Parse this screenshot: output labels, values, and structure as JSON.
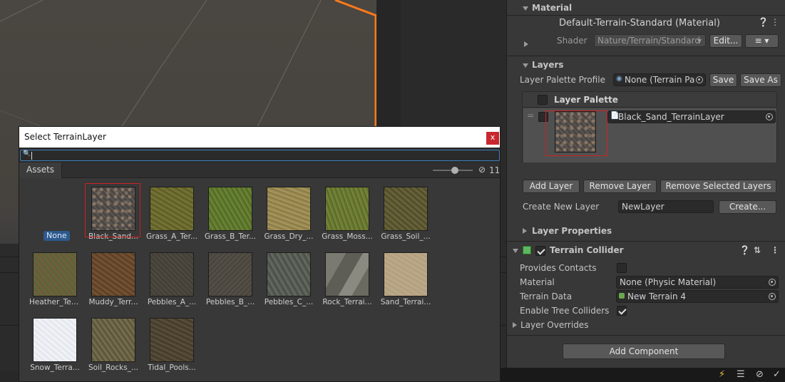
{
  "inspector": {
    "material": {
      "header": "Material",
      "name": "Default-Terrain-Standard (Material)",
      "shader_label": "Shader",
      "shader_value": "Nature/Terrain/Standard",
      "edit_label": "Edit..."
    },
    "layers": {
      "header": "Layers",
      "palette_profile_label": "Layer Palette Profile",
      "palette_profile_value": "None (Terrain Pa",
      "save_label": "Save",
      "save_as_label": "Save As",
      "palette_title": "Layer Palette",
      "selected_layer": "Black_Sand_TerrainLayer",
      "add_layer": "Add Layer",
      "remove_layer": "Remove Layer",
      "remove_selected": "Remove Selected Layers",
      "create_new_label": "Create New Layer",
      "new_layer_value": "NewLayer",
      "create_button": "Create...",
      "properties_header": "Layer Properties"
    },
    "collider": {
      "header": "Terrain Collider",
      "provides_contacts_label": "Provides Contacts",
      "provides_contacts": false,
      "material_label": "Material",
      "material_value": "None (Physic Material)",
      "terrain_data_label": "Terrain Data",
      "terrain_data_value": "New Terrain 4",
      "tree_colliders_label": "Enable Tree Colliders",
      "tree_colliders": true,
      "overrides_header": "Layer Overrides"
    },
    "add_component": "Add Component"
  },
  "dialog": {
    "title": "Select TerrainLayer",
    "close_label": "x",
    "search_value": "",
    "tab_assets": "Assets",
    "hidden_count": "11",
    "none_label": "None",
    "items": [
      {
        "name": "Black_Sand...",
        "tex": "t-black",
        "selected": true
      },
      {
        "name": "Grass_A_Ter...",
        "tex": "t-grassA"
      },
      {
        "name": "Grass_B_Ter...",
        "tex": "t-grassB"
      },
      {
        "name": "Grass_Dry_...",
        "tex": "t-grassDry"
      },
      {
        "name": "Grass_Moss...",
        "tex": "t-moss"
      },
      {
        "name": "Grass_Soil_...",
        "tex": "t-soil"
      },
      {
        "name": "Heather_Ter...",
        "tex": "t-heather"
      },
      {
        "name": "Muddy_Terr...",
        "tex": "t-muddy"
      },
      {
        "name": "Pebbles_A_...",
        "tex": "t-pebA"
      },
      {
        "name": "Pebbles_B_...",
        "tex": "t-pebB"
      },
      {
        "name": "Pebbles_C_...",
        "tex": "t-pebC"
      },
      {
        "name": "Rock_Terrai...",
        "tex": "t-rock"
      },
      {
        "name": "Sand_Terrai...",
        "tex": "t-sand"
      },
      {
        "name": "Snow_Terra...",
        "tex": "t-snow"
      },
      {
        "name": "Soil_Rocks_...",
        "tex": "t-soilrocks"
      },
      {
        "name": "Tidal_Pools...",
        "tex": "t-tidal"
      }
    ]
  },
  "colors": {
    "selection_outline": "#cc2222",
    "selection_border_orange": "#ff7a1a",
    "close_button": "#c8282d",
    "none_badge": "#2d5a8e"
  }
}
